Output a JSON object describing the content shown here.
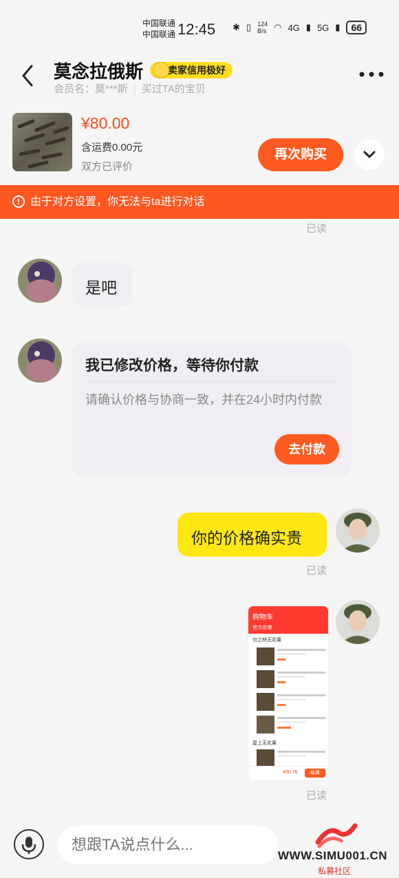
{
  "status_bar": {
    "carrier1": "中国联通",
    "carrier2": "中国联通",
    "time": "12:45",
    "speed": "124\nB/s",
    "network1": "4G",
    "network2": "5G",
    "battery": "66"
  },
  "header": {
    "title": "莫念拉俄斯",
    "seller_badge": "卖家信用极好",
    "member_name": "会员名：莫***斯",
    "bought": "买过TA的宝贝"
  },
  "product": {
    "price": "¥80.00",
    "shipping": "含运费0.00元",
    "rated": "双方已评价",
    "buy_again": "再次购买"
  },
  "notice": "由于对方设置，你无法与ta进行对话",
  "messages": {
    "read_label": "已读",
    "msg1": "是吧",
    "card": {
      "title": "我已修改价格，等待你付款",
      "desc": "请确认价格与协商一致，并在24小时内付款",
      "button": "去付款"
    },
    "msg3": "你的价格确实贵",
    "screenshot": {
      "title": "购物车",
      "tab": "官方店铺",
      "shop1": "勿之林无花果",
      "shop2": "屋上无花果",
      "checkout": "结算",
      "total": "¥30.76"
    }
  },
  "input": {
    "placeholder": "想跟TA说点什么..."
  },
  "watermark": {
    "site": "WWW.SIMU001.CN",
    "label": "私募社区"
  },
  "colors": {
    "accent": "#ff5a1f",
    "notice": "#ff5722",
    "my_bubble": "#ffe713"
  }
}
